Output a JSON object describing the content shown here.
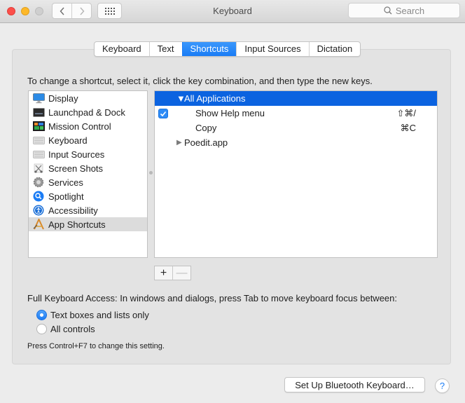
{
  "window": {
    "title": "Keyboard",
    "search_placeholder": "Search",
    "back_icon": "chevron-left-icon",
    "forward_icon": "chevron-right-icon",
    "grid_icon": "show-all-grid-icon"
  },
  "tabs": [
    {
      "label": "Keyboard",
      "active": false
    },
    {
      "label": "Text",
      "active": false
    },
    {
      "label": "Shortcuts",
      "active": true
    },
    {
      "label": "Input Sources",
      "active": false
    },
    {
      "label": "Dictation",
      "active": false
    }
  ],
  "instructions": "To change a shortcut, select it, click the key combination, and then type the new keys.",
  "categories": [
    {
      "label": "Display",
      "icon": "display-icon"
    },
    {
      "label": "Launchpad & Dock",
      "icon": "launchpad-dock-icon"
    },
    {
      "label": "Mission Control",
      "icon": "mission-control-icon"
    },
    {
      "label": "Keyboard",
      "icon": "keyboard-icon"
    },
    {
      "label": "Input Sources",
      "icon": "keyboard-icon"
    },
    {
      "label": "Screen Shots",
      "icon": "screenshot-icon"
    },
    {
      "label": "Services",
      "icon": "gear-icon"
    },
    {
      "label": "Spotlight",
      "icon": "spotlight-search-icon"
    },
    {
      "label": "Accessibility",
      "icon": "accessibility-icon"
    },
    {
      "label": "App Shortcuts",
      "icon": "app-shortcuts-icon",
      "selected": true
    }
  ],
  "shortcuts": {
    "group_all": {
      "label": "All Applications",
      "expanded": true
    },
    "items": [
      {
        "label": "Show Help menu",
        "keys": "⇧⌘/",
        "checked": true
      },
      {
        "label": "Copy",
        "keys": "⌘C",
        "checked": false
      }
    ],
    "group_app": {
      "label": "Poedit.app",
      "expanded": false
    }
  },
  "buttons": {
    "add": "+",
    "remove": "—",
    "bluetooth": "Set Up Bluetooth Keyboard…",
    "help": "?"
  },
  "full_keyboard_access": {
    "label": "Full Keyboard Access: In windows and dialogs, press Tab to move keyboard focus between:",
    "options": [
      {
        "label": "Text boxes and lists only",
        "selected": true
      },
      {
        "label": "All controls",
        "selected": false
      }
    ],
    "hint": "Press Control+F7 to change this setting."
  },
  "colors": {
    "accent": "#1a7cf5",
    "selection": "#0b63e0",
    "close": "#fc4f4a",
    "minimize": "#fdb829"
  }
}
